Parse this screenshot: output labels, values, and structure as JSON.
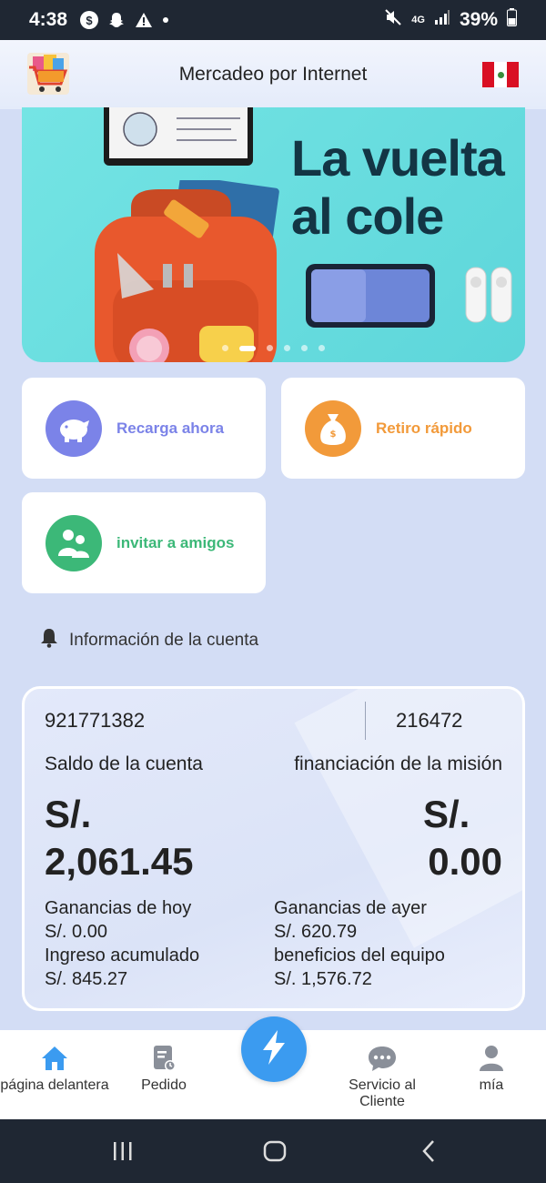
{
  "status_bar": {
    "time": "4:38",
    "network": "4G",
    "battery": "39%"
  },
  "header": {
    "title": "Mercadeo por Internet"
  },
  "banner": {
    "headline": "La vuelta al cole",
    "active_slide": 1,
    "slide_count": 6
  },
  "actions": {
    "recharge": {
      "label": "Recarga ahora",
      "icon": "piggy-bank-icon",
      "color": "#7b83e8"
    },
    "withdraw": {
      "label": "Retiro rápido",
      "icon": "money-bag-icon",
      "color": "#f29a3a"
    },
    "invite": {
      "label": "invitar a amigos",
      "icon": "users-icon",
      "color": "#3cb878"
    }
  },
  "info": {
    "title": "Información de la cuenta"
  },
  "account": {
    "id": "921771382",
    "code": "216472",
    "balance_label": "Saldo de la cuenta",
    "mission_label": "financiación de la misión",
    "balance_currency": "S/.",
    "balance_amount": "2,061.45",
    "mission_currency": "S/.",
    "mission_amount": "0.00",
    "today_label": "Ganancias de hoy",
    "today_value": "S/. 0.00",
    "yesterday_label": "Ganancias de ayer",
    "yesterday_value": "S/. 620.79",
    "accumulated_label": "Ingreso acumulado",
    "accumulated_value": "S/. 845.27",
    "team_label": "beneficios del equipo",
    "team_value": "S/. 1,576.72"
  },
  "nav": {
    "home": "página delantera",
    "orders": "Pedido",
    "support": "Servicio al Cliente",
    "mine": "mía",
    "accent": "#3b9bf0"
  }
}
